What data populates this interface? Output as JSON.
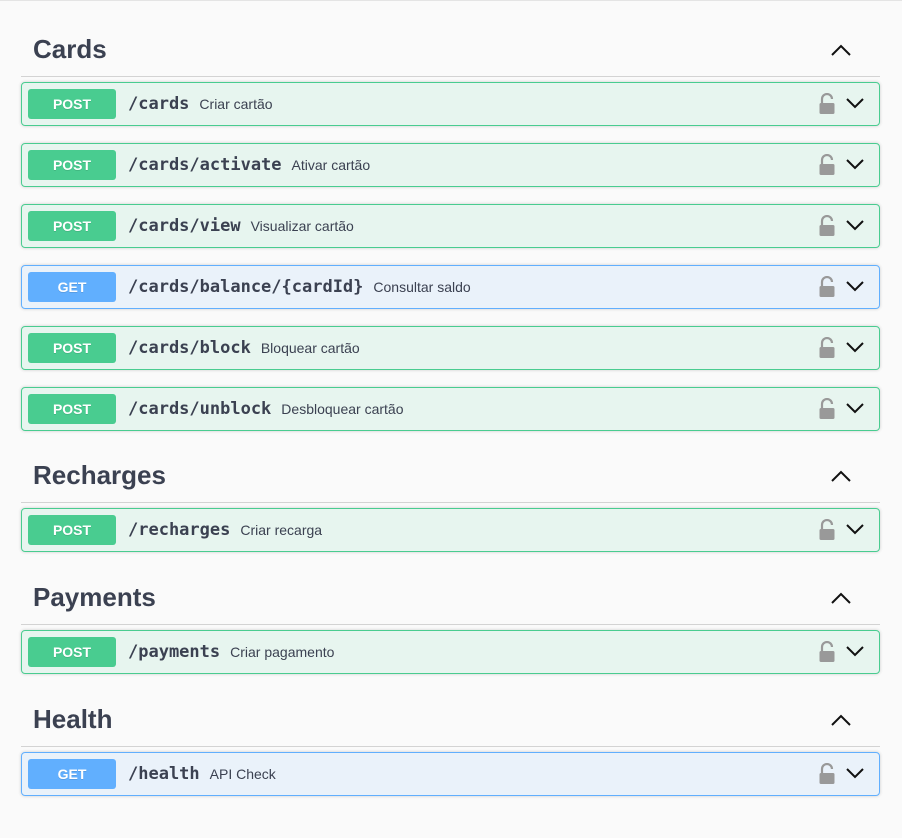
{
  "sections": [
    {
      "title": "Cards",
      "operations": [
        {
          "method": "POST",
          "path": "/cards",
          "summary": "Criar cartão"
        },
        {
          "method": "POST",
          "path": "/cards/activate",
          "summary": "Ativar cartão"
        },
        {
          "method": "POST",
          "path": "/cards/view",
          "summary": "Visualizar cartão"
        },
        {
          "method": "GET",
          "path": "/cards/balance/{cardId}",
          "summary": "Consultar saldo"
        },
        {
          "method": "POST",
          "path": "/cards/block",
          "summary": "Bloquear cartão"
        },
        {
          "method": "POST",
          "path": "/cards/unblock",
          "summary": "Desbloquear cartão"
        }
      ]
    },
    {
      "title": "Recharges",
      "operations": [
        {
          "method": "POST",
          "path": "/recharges",
          "summary": "Criar recarga"
        }
      ]
    },
    {
      "title": "Payments",
      "operations": [
        {
          "method": "POST",
          "path": "/payments",
          "summary": "Criar pagamento"
        }
      ]
    },
    {
      "title": "Health",
      "operations": [
        {
          "method": "GET",
          "path": "/health",
          "summary": "API Check"
        }
      ]
    }
  ],
  "colors": {
    "post": "#49cc90",
    "get": "#61affe",
    "text": "#3b4151"
  },
  "icons": {
    "section_toggle": "chevron-up-icon",
    "lock": "lock-icon",
    "expand": "chevron-down-icon"
  }
}
